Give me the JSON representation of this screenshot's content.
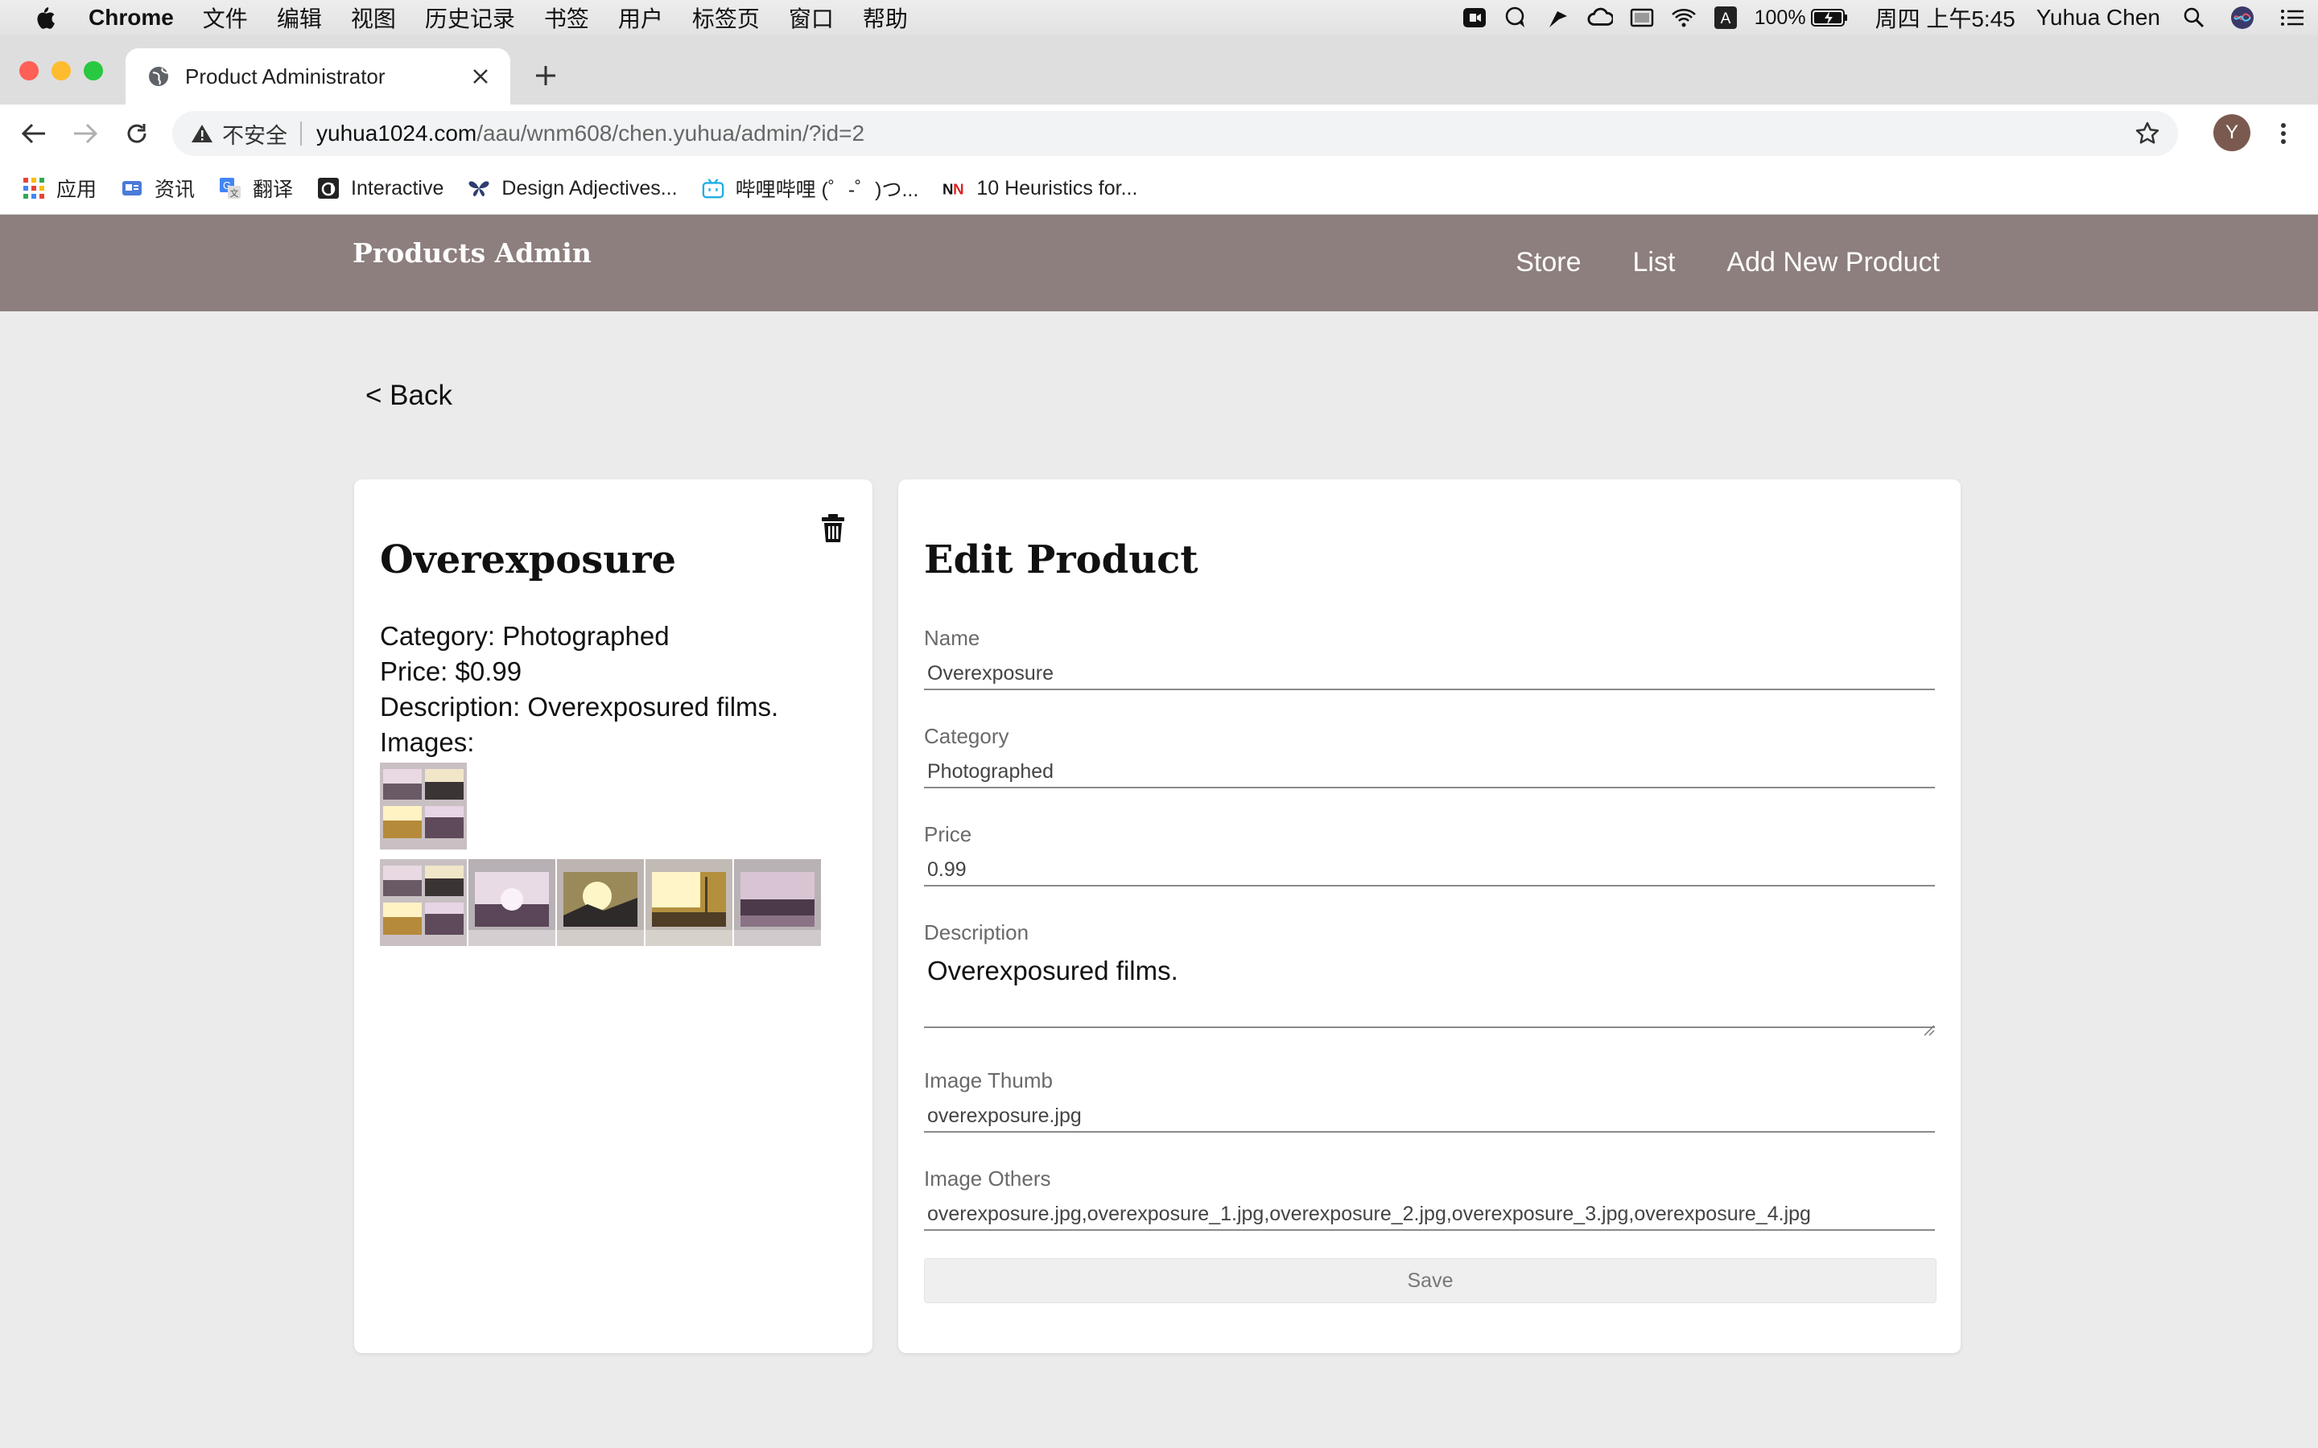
{
  "menubar": {
    "app_name": "Chrome",
    "menus": [
      "文件",
      "编辑",
      "视图",
      "历史记录",
      "书签",
      "用户",
      "标签页",
      "窗口",
      "帮助"
    ],
    "battery": "100%",
    "datetime": "周四 上午5:45",
    "user": "Yuhua Chen",
    "input_method": "A",
    "icons": [
      "apple-icon",
      "video-icon",
      "chat-icon",
      "flag-icon",
      "creative-cloud-icon",
      "display-icon",
      "wifi-icon",
      "keyboard-input-icon",
      "battery-icon",
      "spotlight-icon",
      "siri-icon",
      "list-icon"
    ]
  },
  "browser": {
    "tab_title": "Product Administrator",
    "insecure_label": "不安全",
    "url_host": "yuhua1024.com",
    "url_path": "/aau/wnm608/chen.yuhua/admin/?id=2",
    "profile_initial": "Y"
  },
  "bookmarks": [
    {
      "label": "应用",
      "icon": "apps-grid-icon"
    },
    {
      "label": "资讯",
      "icon": "news-icon"
    },
    {
      "label": "翻译",
      "icon": "translate-icon"
    },
    {
      "label": "Interactive",
      "icon": "interactive-icon"
    },
    {
      "label": "Design Adjectives...",
      "icon": "butterfly-icon"
    },
    {
      "label": "哔哩哔哩 (゜-゜)つ...",
      "icon": "bilibili-icon"
    },
    {
      "label": "10 Heuristics for...",
      "icon": "nn-icon"
    }
  ],
  "site": {
    "brand": "Products Admin",
    "nav": [
      "Store",
      "List",
      "Add New Product"
    ]
  },
  "page": {
    "back_label": "< Back"
  },
  "product": {
    "name": "Overexposure",
    "category_line": "Category: Photographed",
    "price_line": "Price: $0.99",
    "description_line": "Description: Overexposured films.",
    "images_label": "Images:"
  },
  "form": {
    "title": "Edit Product",
    "name_label": "Name",
    "name_value": "Overexposure",
    "category_label": "Category",
    "category_value": "Photographed",
    "price_label": "Price",
    "price_value": "0.99",
    "description_label": "Description",
    "description_value": "Overexposured films.",
    "thumb_label": "Image Thumb",
    "thumb_value": "overexposure.jpg",
    "others_label": "Image Others",
    "others_value": "overexposure.jpg,overexposure_1.jpg,overexposure_2.jpg,overexposure_3.jpg,overexposure_4.jpg",
    "save_label": "Save"
  },
  "colors": {
    "header_bg": "#8d7f7e",
    "page_bg": "#ecebeb",
    "card_bg": "#ffffff"
  }
}
